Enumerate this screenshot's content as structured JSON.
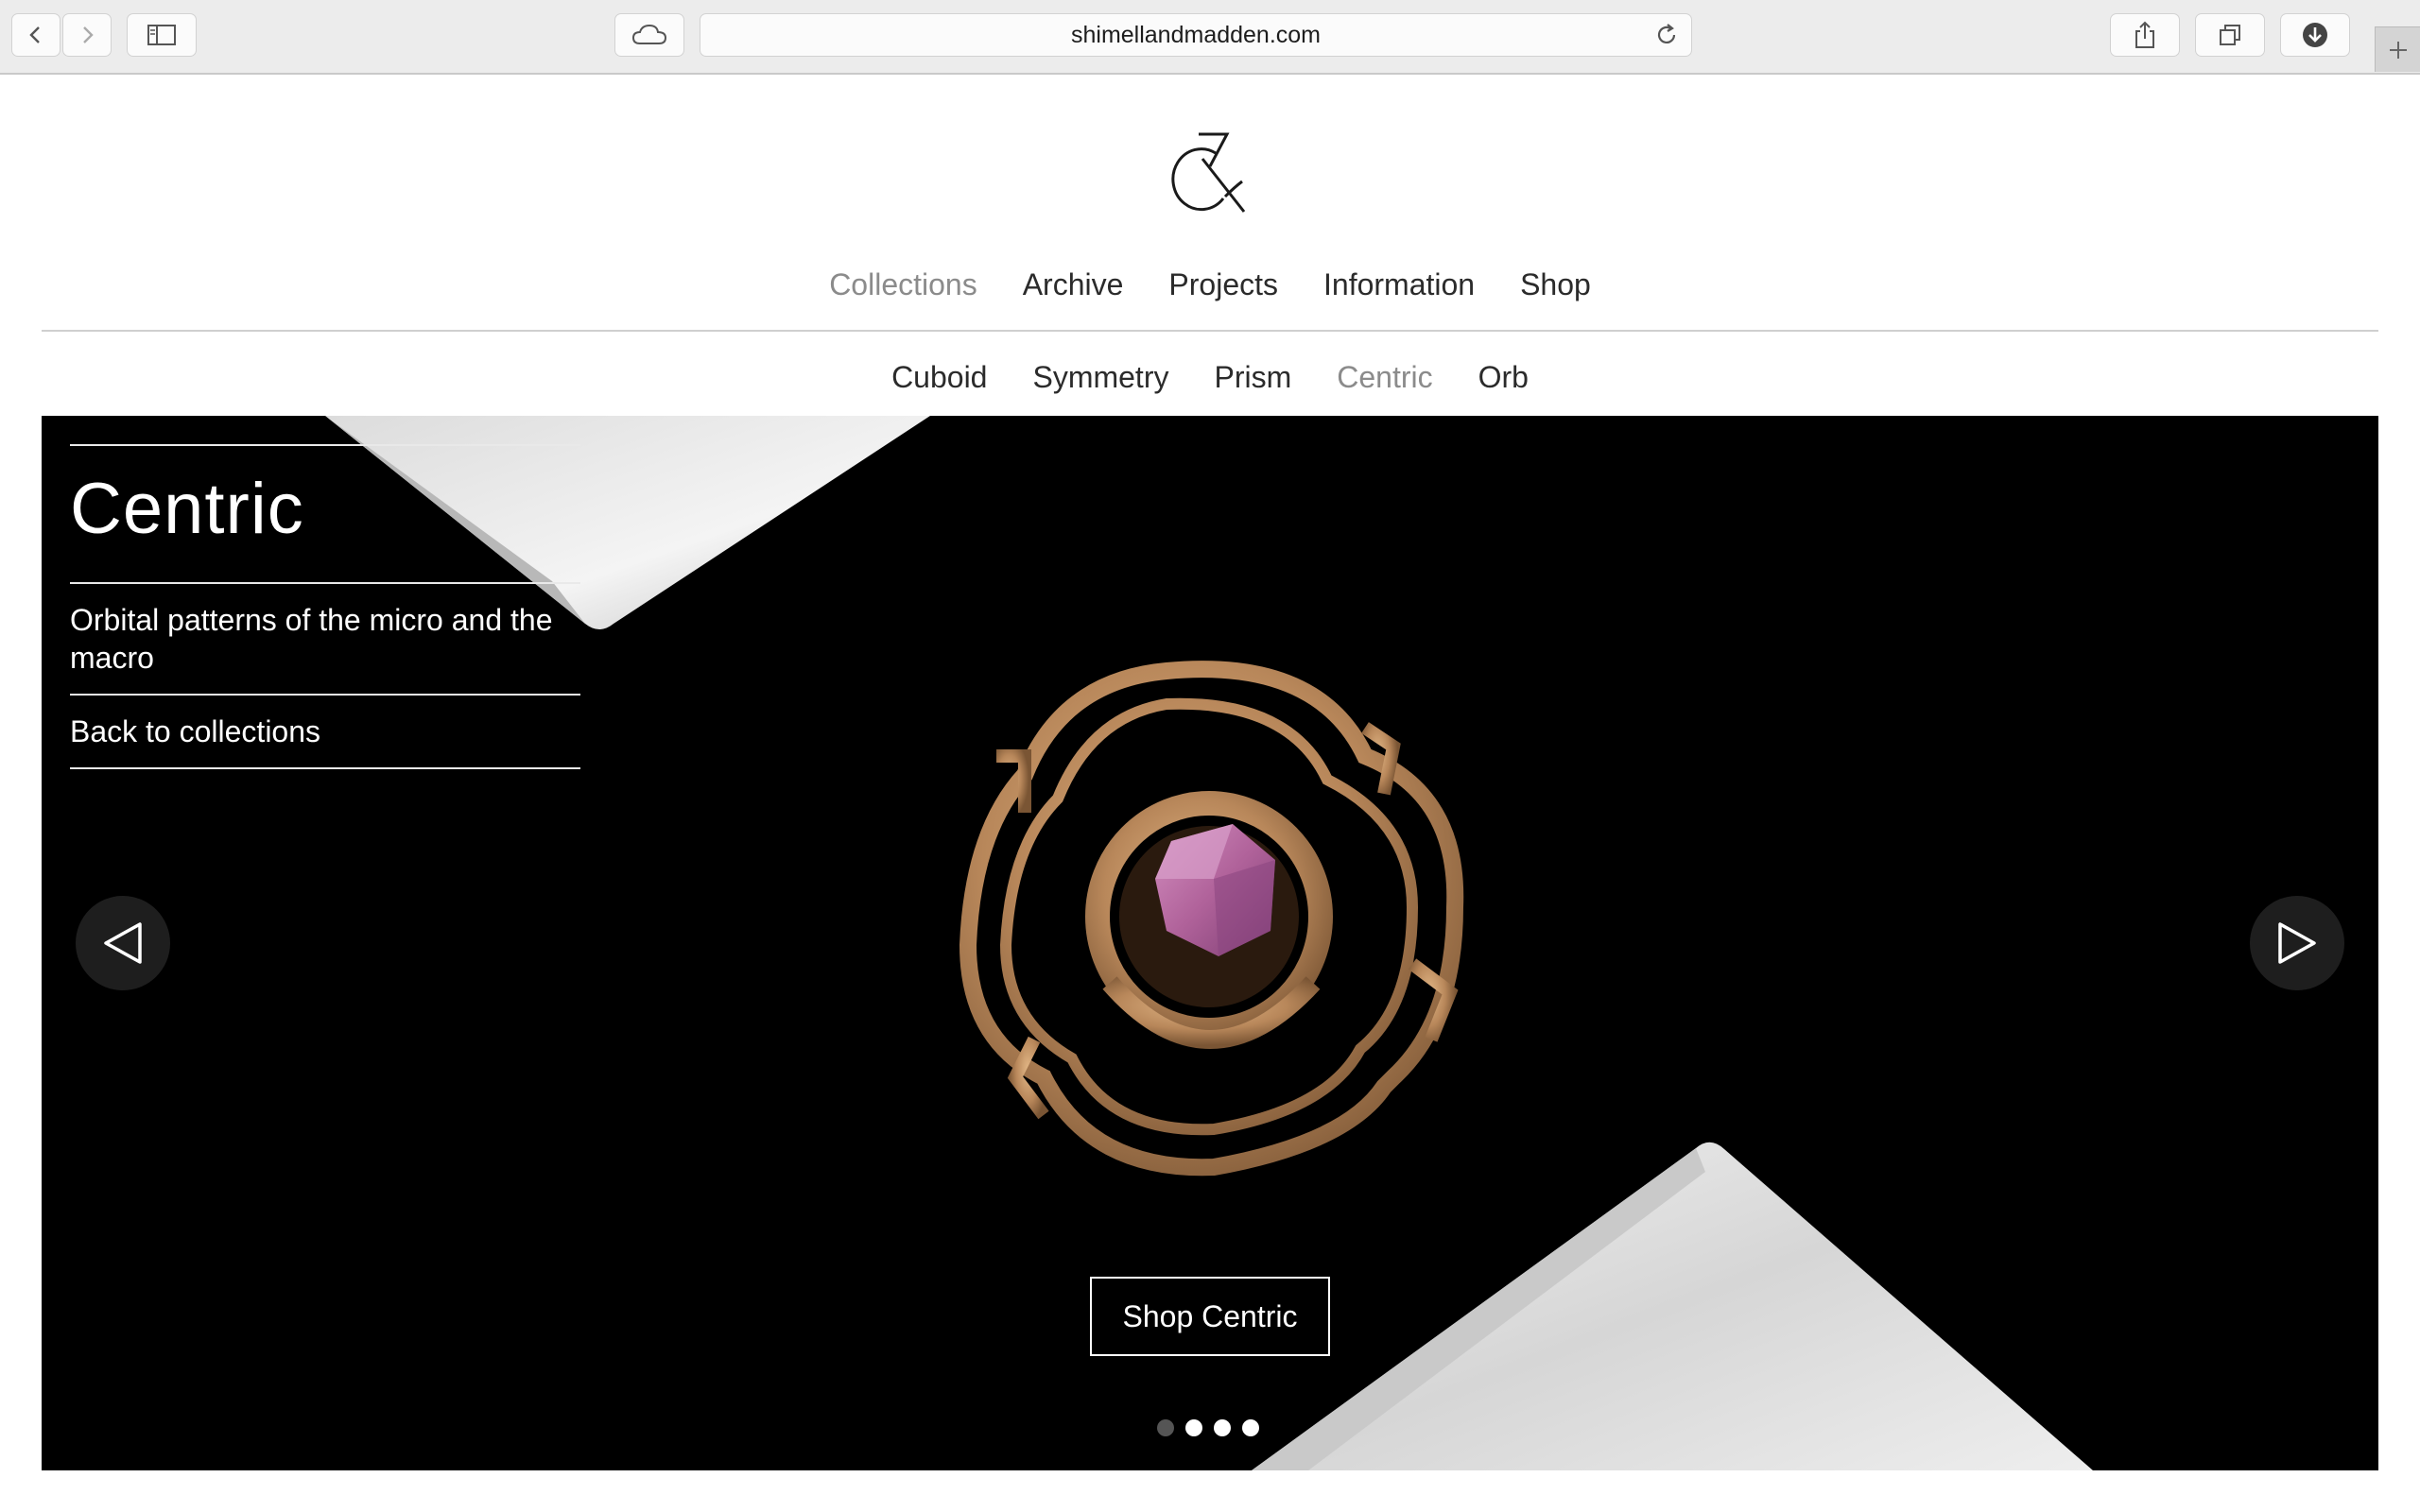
{
  "browser": {
    "url": "shimellandmadden.com",
    "icons": [
      "back-icon",
      "forward-icon",
      "sidebar-icon",
      "cloud-icon",
      "reload-icon",
      "share-icon",
      "tabs-icon",
      "download-icon",
      "new-tab-icon"
    ]
  },
  "site": {
    "logo_icon": "ampersand-logo",
    "nav": [
      {
        "label": "Collections",
        "active": true
      },
      {
        "label": "Archive",
        "active": false
      },
      {
        "label": "Projects",
        "active": false
      },
      {
        "label": "Information",
        "active": false
      },
      {
        "label": "Shop",
        "active": false
      }
    ],
    "subnav": [
      {
        "label": "Cuboid",
        "active": false
      },
      {
        "label": "Symmetry",
        "active": false
      },
      {
        "label": "Prism",
        "active": false
      },
      {
        "label": "Centric",
        "active": true
      },
      {
        "label": "Orb",
        "active": false
      }
    ]
  },
  "hero": {
    "title": "Centric",
    "description": "Orbital patterns of the micro and the macro",
    "back_link": "Back to collections",
    "shop_button": "Shop Centric",
    "slide_count": 4,
    "active_slide": 1,
    "colors": {
      "gold": "#b8875a",
      "gem": "#b0629a",
      "background": "#000000"
    }
  }
}
